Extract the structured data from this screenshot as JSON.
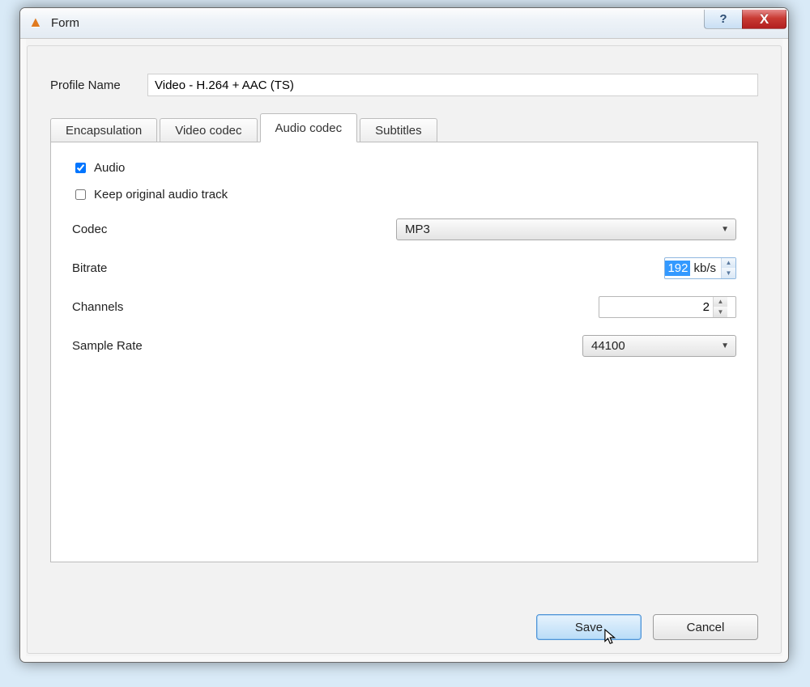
{
  "window": {
    "title": "Form"
  },
  "profile": {
    "label": "Profile Name",
    "value": "Video - H.264 + AAC (TS)"
  },
  "tabs": {
    "encapsulation": "Encapsulation",
    "video_codec": "Video codec",
    "audio_codec": "Audio codec",
    "subtitles": "Subtitles"
  },
  "audio": {
    "check_audio": {
      "label": "Audio",
      "checked": true
    },
    "check_keep": {
      "label": "Keep original audio track",
      "checked": false
    },
    "codec": {
      "label": "Codec",
      "value": "MP3"
    },
    "bitrate": {
      "label": "Bitrate",
      "value": "192",
      "unit": "kb/s"
    },
    "channels": {
      "label": "Channels",
      "value": "2"
    },
    "sample": {
      "label": "Sample Rate",
      "value": "44100"
    }
  },
  "buttons": {
    "save": "Save",
    "cancel": "Cancel"
  },
  "titlebar": {
    "help": "?",
    "close": "X"
  }
}
